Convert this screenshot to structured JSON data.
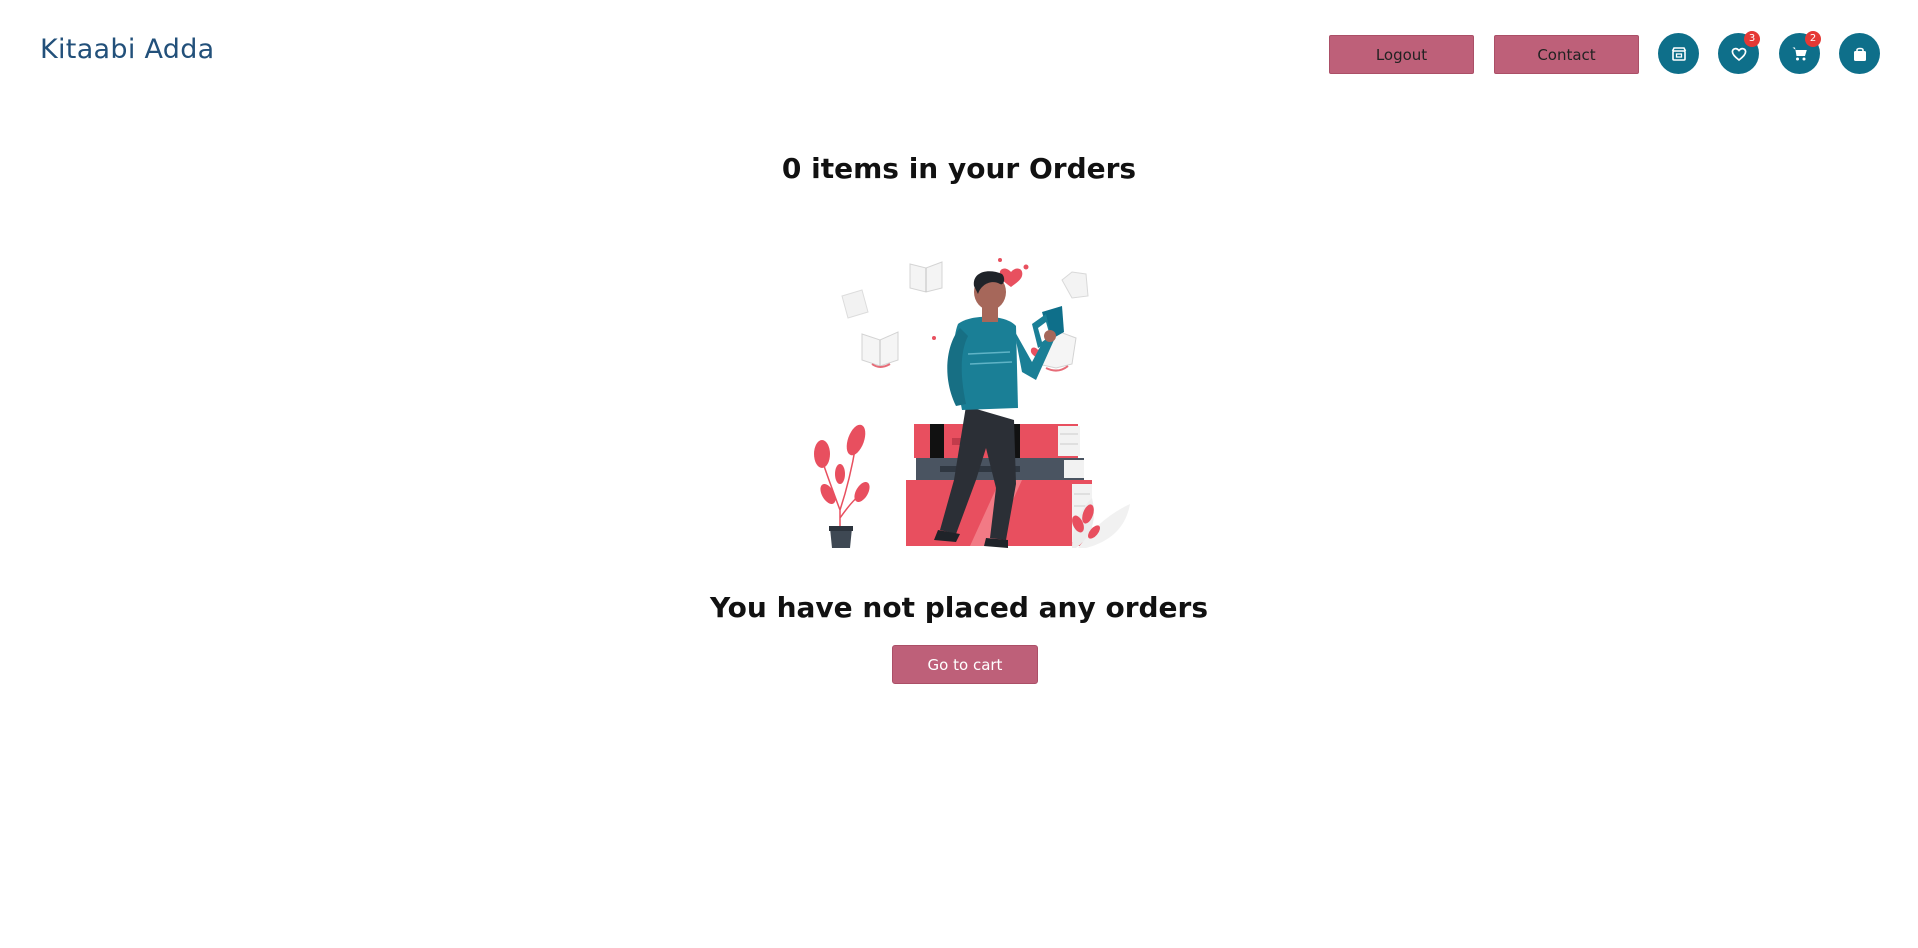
{
  "brand": {
    "name": "Kitaabi Adda",
    "color": "#22507a"
  },
  "nav": {
    "logout_label": "Logout",
    "contact_label": "Contact",
    "icons": [
      {
        "name": "store-icon",
        "badge": ""
      },
      {
        "name": "heart-icon",
        "badge": "3"
      },
      {
        "name": "cart-icon",
        "badge": "2"
      },
      {
        "name": "bag-icon",
        "badge": ""
      }
    ]
  },
  "main": {
    "title": "0 items in your Orders",
    "empty_message": "You have not placed any orders",
    "cart_button_label": "Go to cart"
  },
  "colors": {
    "accent_button": "#be6079",
    "icon_button": "#0e6f8a",
    "badge": "#e53935"
  }
}
